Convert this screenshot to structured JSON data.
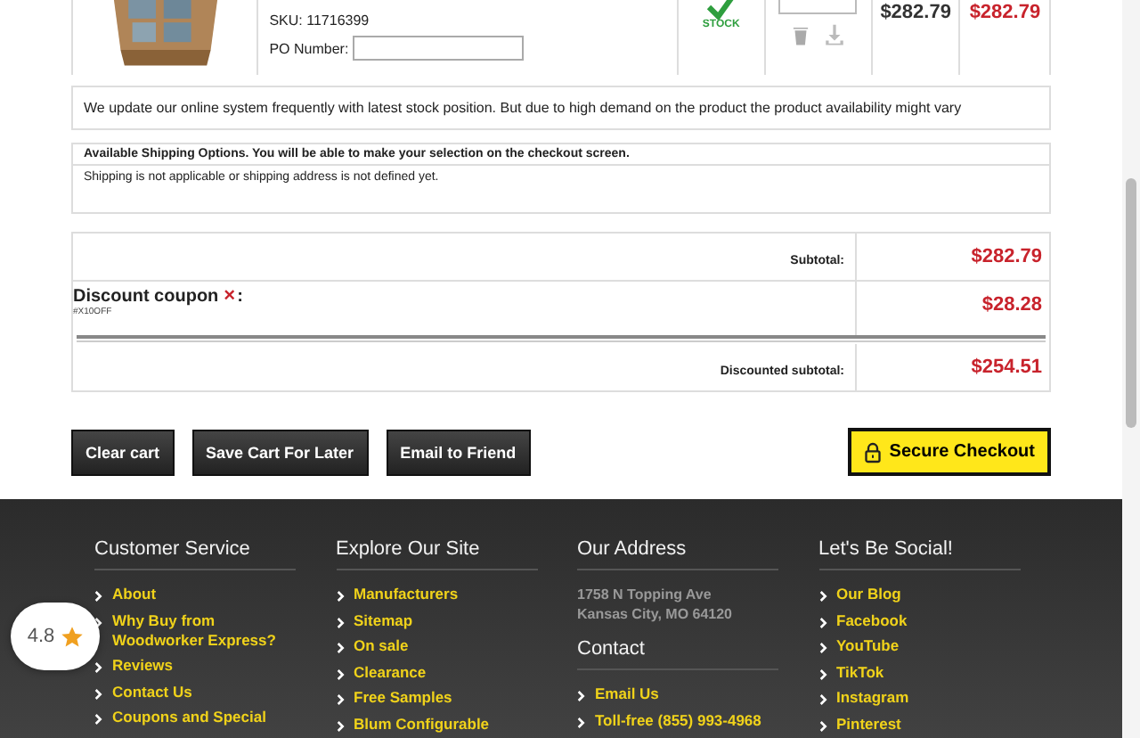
{
  "cart_item": {
    "sku": "SKU: 11716399",
    "po_label": "PO Number:",
    "stock": "STOCK",
    "price": "$282.79",
    "total": "$282.79"
  },
  "notice": "We update our online system frequently with latest stock position. But due to high demand on the product the product availability might vary",
  "shipping": {
    "title": "Available Shipping Options. You will be able to make your selection on the checkout screen.",
    "message": "Shipping is not applicable or shipping address is not defined yet."
  },
  "totals": {
    "subtotal_label": "Subtotal:",
    "subtotal": "$282.79",
    "coupon_label": "Discount coupon",
    "coupon_remove": "×",
    "coupon_colon": ":",
    "coupon_code": "#X10OFF",
    "discount": "$28.28",
    "discounted_label": "Discounted subtotal:",
    "discounted": "$254.51"
  },
  "buttons": [
    "Clear cart",
    "Save Cart For Later",
    "Email to Friend"
  ],
  "checkout": "Secure Checkout",
  "footer": {
    "columns": [
      {
        "sections": [
          {
            "heading": "Customer Service",
            "links": [
              "About",
              "Why Buy from Woodworker Express?",
              "Reviews",
              "Contact Us",
              "Coupons and Special"
            ]
          }
        ]
      },
      {
        "sections": [
          {
            "heading": "Explore Our Site",
            "links": [
              "Manufacturers",
              "Sitemap",
              "On sale",
              "Clearance",
              "Free Samples",
              "Blum Configurable"
            ]
          }
        ]
      },
      {
        "sections": [
          {
            "heading": "Our Address",
            "lines": [
              "1758 N Topping Ave",
              "Kansas City, MO 64120"
            ]
          },
          {
            "heading": "Contact",
            "links": [
              "Email Us",
              "Toll-free (855) 993-4968"
            ]
          }
        ]
      },
      {
        "sections": [
          {
            "heading": "Let's Be Social!",
            "links": [
              "Our Blog",
              "Facebook",
              "YouTube",
              "TikTok",
              "Instagram",
              "Pinterest"
            ]
          }
        ]
      }
    ]
  },
  "rating": {
    "value": "4.8"
  }
}
